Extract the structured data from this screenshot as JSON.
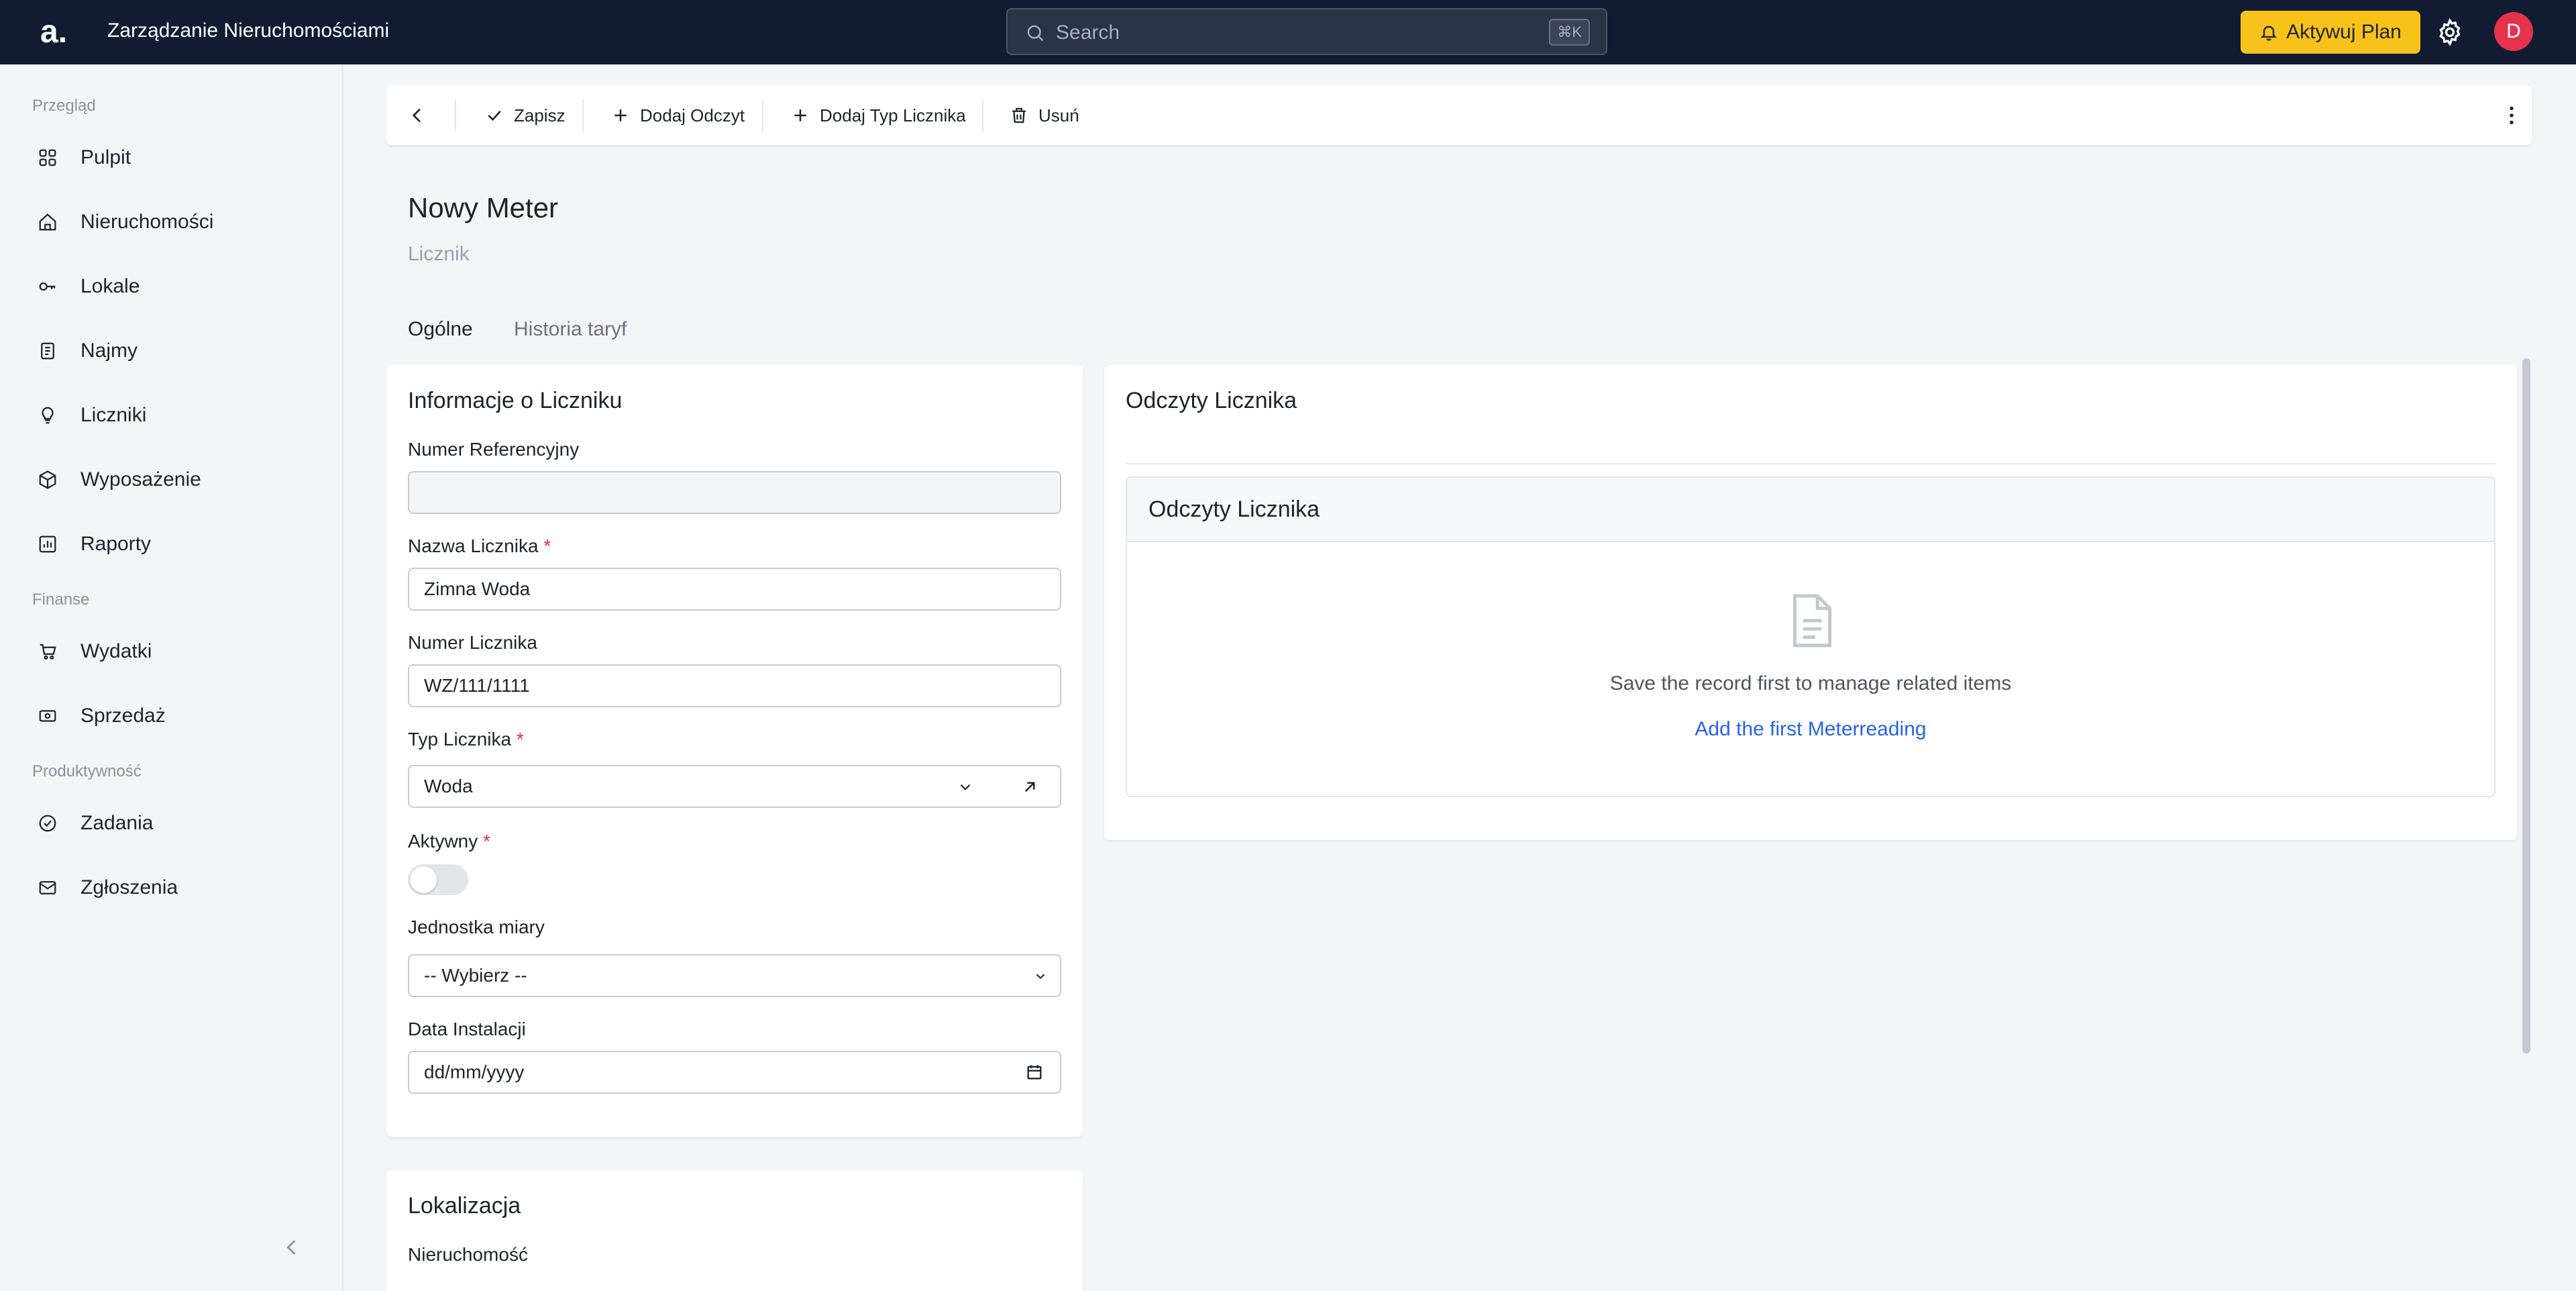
{
  "header": {
    "logo": "a.",
    "app_title": "Zarządzanie Nieruchomościami",
    "search_placeholder": "Search",
    "search_shortcut": "⌘K",
    "upgrade_label": "Aktywuj Plan",
    "avatar_initial": "D"
  },
  "sidebar": {
    "sections": [
      {
        "label": "Przegląd",
        "items": [
          {
            "label": "Pulpit",
            "icon": "grid-icon"
          },
          {
            "label": "Nieruchomości",
            "icon": "home-icon"
          },
          {
            "label": "Lokale",
            "icon": "key-icon"
          },
          {
            "label": "Najmy",
            "icon": "document-icon"
          },
          {
            "label": "Liczniki",
            "icon": "bulb-icon"
          },
          {
            "label": "Wyposażenie",
            "icon": "box-icon"
          },
          {
            "label": "Raporty",
            "icon": "chart-icon"
          }
        ]
      },
      {
        "label": "Finanse",
        "items": [
          {
            "label": "Wydatki",
            "icon": "cart-icon"
          },
          {
            "label": "Sprzedaż",
            "icon": "money-icon"
          }
        ]
      },
      {
        "label": "Produktywność",
        "items": [
          {
            "label": "Zadania",
            "icon": "check-circle-icon"
          },
          {
            "label": "Zgłoszenia",
            "icon": "mail-icon"
          }
        ]
      }
    ]
  },
  "toolbar": {
    "save_label": "Zapisz",
    "add_reading_label": "Dodaj Odczyt",
    "add_meter_type_label": "Dodaj Typ Licznika",
    "delete_label": "Usuń"
  },
  "page": {
    "title": "Nowy Meter",
    "subtitle": "Licznik",
    "tabs": [
      {
        "label": "Ogólne",
        "active": true
      },
      {
        "label": "Historia taryf",
        "active": false
      }
    ]
  },
  "info_card": {
    "title": "Informacje o Liczniku",
    "ref_number_label": "Numer Referencyjny",
    "ref_number_value": "",
    "name_label": "Nazwa Licznika",
    "name_value": "Zimna Woda",
    "number_label": "Numer Licznika",
    "number_value": "WZ/111/1111",
    "type_label": "Typ Licznika",
    "type_value": "Woda",
    "active_label": "Aktywny",
    "active_value": false,
    "unit_label": "Jednostka miary",
    "unit_value": "-- Wybierz --",
    "install_date_label": "Data Instalacji",
    "install_date_placeholder": "dd/mm/yyyy",
    "required_mark": "*"
  },
  "location_card": {
    "title": "Lokalizacja",
    "property_label": "Nieruchomość"
  },
  "readings_card": {
    "title": "Odczyty Licznika",
    "inner_title": "Odczyty Licznika",
    "empty_message": "Save the record first to manage related items",
    "add_link": "Add the first Meterreading"
  },
  "colors": {
    "topbar": "#111c33",
    "accent_yellow": "#f7c21a",
    "avatar": "#e5334b",
    "link_blue": "#2563eb",
    "required_red": "#e02d3c"
  }
}
